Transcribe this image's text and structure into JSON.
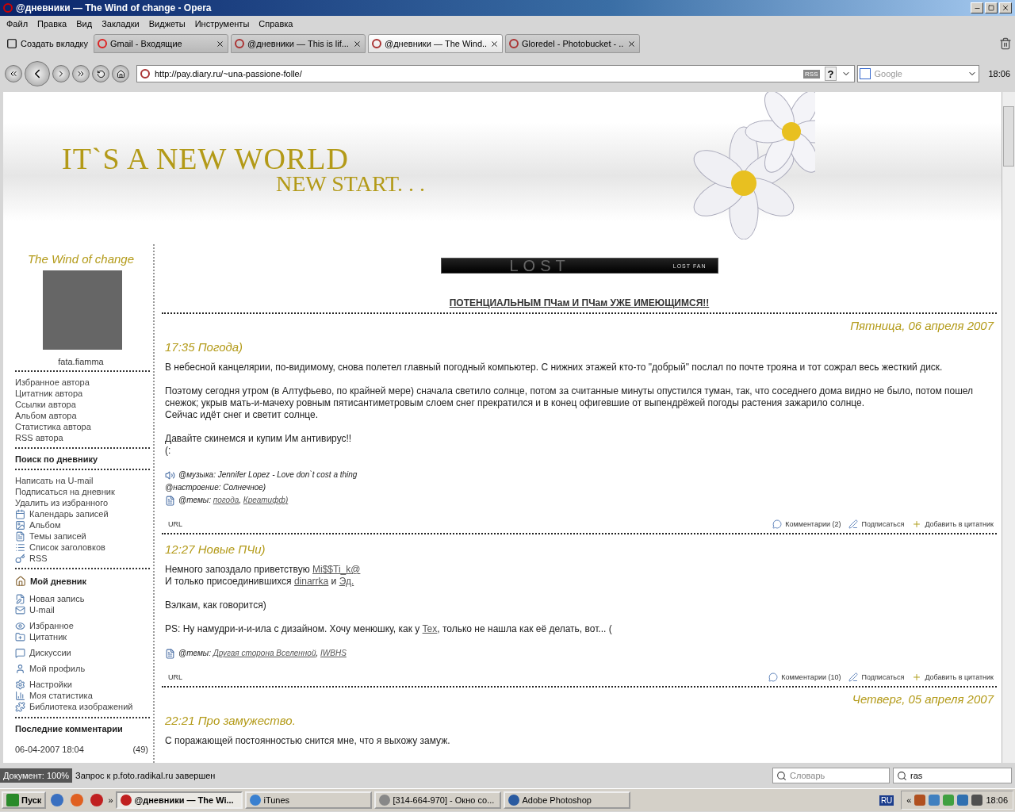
{
  "window": {
    "title": "@дневники — The Wind of change - Opera"
  },
  "menu": [
    "Файл",
    "Правка",
    "Вид",
    "Закладки",
    "Виджеты",
    "Инструменты",
    "Справка"
  ],
  "new_tab": "Создать вкладку",
  "tabs": [
    {
      "label": "Gmail - Входящие",
      "selected": false
    },
    {
      "label": "@дневники — This is lif...",
      "selected": false
    },
    {
      "label": "@дневники — The Wind...",
      "selected": true
    },
    {
      "label": "Gloredel - Photobucket - ...",
      "selected": false
    }
  ],
  "address": {
    "url": "http://pay.diary.ru/~una-passione-folle/",
    "rss": "RSS",
    "help": "?"
  },
  "search": {
    "placeholder": "Google"
  },
  "clock": "18:06",
  "header": {
    "line1": "IT`S A NEW WORLD",
    "line2": "NEW START. . ."
  },
  "sidebar": {
    "blog_title": "The Wind of change",
    "username": "fata.fiamma",
    "author_links": [
      "Избранное автора",
      "Цитатник автора",
      "Ссылки автора",
      "Альбом автора",
      "Статистика автора",
      "RSS автора"
    ],
    "search_title": "Поиск по дневнику",
    "actions": [
      {
        "label": "Написать на U-mail",
        "kind": "plain"
      },
      {
        "label": "Подписаться на дневник",
        "kind": "plain"
      },
      {
        "label": "Удалить из избранного",
        "kind": "plain"
      },
      {
        "label": "Календарь записей",
        "kind": "icon"
      },
      {
        "label": "Альбом",
        "kind": "icon"
      },
      {
        "label": "Темы записей",
        "kind": "icon"
      },
      {
        "label": "Список заголовков",
        "kind": "icon"
      },
      {
        "label": "RSS",
        "kind": "icon"
      }
    ],
    "my_diary": {
      "title": "Мой дневник",
      "groups": [
        [
          "Новая запись",
          "U-mail"
        ],
        [
          "Избранное",
          "Цитатник"
        ],
        [
          "Дискуссии"
        ],
        [
          "Мой профиль"
        ],
        [
          "Настройки",
          "Моя статистика",
          "Библиотека изображений"
        ]
      ]
    },
    "recent_comments": {
      "title": "Последние комментарии",
      "rows": [
        {
          "date": "06-04-2007 18:04",
          "count": "(49)"
        }
      ]
    }
  },
  "content": {
    "banner": {
      "title": "LOST",
      "subtitle": "LOST FAN"
    },
    "announcement": "ПОТЕНЦИАЛЬНЫМ ПЧам И ПЧам УЖЕ ИМЕЮЩИМСЯ!!",
    "days": [
      {
        "date": "Пятница, 06 апреля 2007",
        "posts": [
          {
            "title": "17:35 Погода)",
            "blocks": [
              [
                [
                  {
                    "text": "В небесной канцелярии, по-видимому, снова полетел главный погодный компьютер. С нижних этажей кто-то \"добрый\" послал по почте трояна и тот сожрал весь жесткий диск.",
                    "link": false
                  }
                ]
              ],
              [
                [
                  {
                    "text": "Поэтому сегодня утром (в Алтуфьево, по крайней мере) сначала светило солнце, потом за считанные минуты опустился туман, так, что соседнего дома видно не было, потом пошел снежок; укрыв мать-и-мачеху ровным пятисантиметровым слоем снег прекратился и в конец офигевшие от выпендрёжей погоды растения зажарило солнце.",
                    "link": false
                  }
                ],
                [
                  {
                    "text": "Сейчас идёт снег и светит солнце.",
                    "link": false
                  }
                ]
              ],
              [
                [
                  {
                    "text": "Давайте скинемся и купим Им антивирус!!",
                    "link": false
                  }
                ],
                [
                  {
                    "text": "(:",
                    "link": false
                  }
                ]
              ]
            ],
            "meta": [
              {
                "kind": "music",
                "label": "@музыка:",
                "value": "Jennifer Lopez - Love don`t cost a thing"
              },
              {
                "kind": "mood",
                "label": "@настроение:",
                "value": "Солнечное)"
              },
              {
                "kind": "topics",
                "label": "@темы:",
                "separator": ",",
                "links": [
                  "погода",
                  "Креатифф)"
                ]
              }
            ],
            "footer": {
              "url": "URL",
              "comments": "Комментарии (2)",
              "subscribe": "Подписаться",
              "quote": "Добавить в цитатник"
            }
          },
          {
            "title": "12:27 Новые ПЧи)",
            "blocks": [
              [
                [
                  {
                    "text": "Немного запоздало приветствую ",
                    "link": false
                  },
                  {
                    "text": "Mi$$Ti_k@",
                    "link": true
                  }
                ],
                [
                  {
                    "text": "И только присоединившихся ",
                    "link": false
                  },
                  {
                    "text": "dinarrka",
                    "link": true
                  },
                  {
                    "text": " и ",
                    "link": false
                  },
                  {
                    "text": "Эд.",
                    "link": true
                  }
                ]
              ],
              [
                [
                  {
                    "text": "Вэлкам, как говорится)",
                    "link": false
                  }
                ]
              ],
              [
                [
                  {
                    "text": "PS: Ну намудри-и-и-ила с дизайном. Хочу менюшку, как у ",
                    "link": false
                  },
                  {
                    "text": "Tex",
                    "link": true
                  },
                  {
                    "text": ", только не нашла как её делать, вот... (",
                    "link": false
                  }
                ]
              ]
            ],
            "meta": [
              {
                "kind": "topics",
                "label": "@темы:",
                "separator": ",",
                "links": [
                  "Другая сторона Вселенной",
                  "IWBHS"
                ]
              }
            ],
            "footer": {
              "url": "URL",
              "comments": "Комментарии (10)",
              "subscribe": "Подписаться",
              "quote": "Добавить в цитатник"
            }
          }
        ]
      },
      {
        "date": "Четверг, 05 апреля 2007",
        "posts": [
          {
            "title": "22:21 Про замужество.",
            "blocks": [
              [
                [
                  {
                    "text": "С поражающей постоянностью снится мне, что я выхожу замуж.",
                    "link": false
                  }
                ]
              ]
            ]
          }
        ]
      }
    ]
  },
  "status_bar": {
    "document": "Документ:",
    "zoom": "100%",
    "message": "Запрос к p.foto.radikal.ru завершен",
    "dictionary_placeholder": "Словарь",
    "search_value": "ras"
  },
  "taskbar": {
    "start": "Пуск",
    "chevron": "»",
    "windows": [
      {
        "label": "@дневники — The Wi...",
        "selected": true
      },
      {
        "label": "iTunes",
        "selected": false
      },
      {
        "label": "[314-664-970] - Окно со...",
        "selected": false
      },
      {
        "label": "Adobe Photoshop",
        "selected": false
      }
    ],
    "language": "RU",
    "tray_chevron": "«",
    "clock": "18:06"
  }
}
